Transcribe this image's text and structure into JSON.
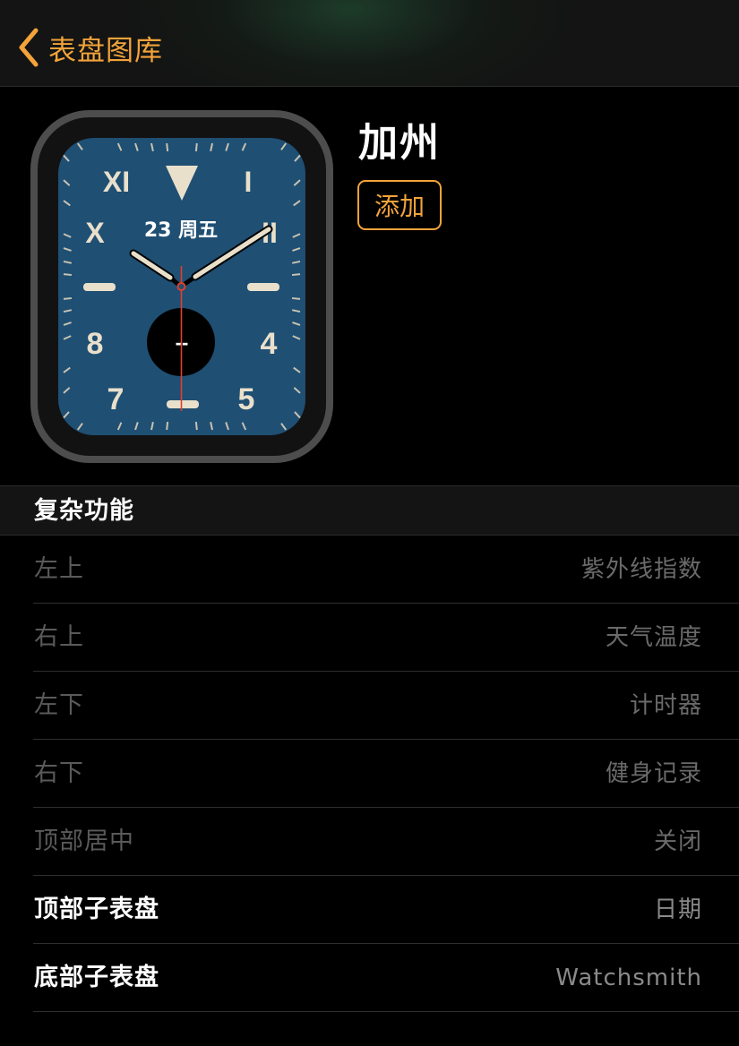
{
  "nav": {
    "back_label": "表盘图库",
    "back_icon": "chevron-left-icon",
    "accent_color": "#f3a33a"
  },
  "face": {
    "name": "加州",
    "add_label": "添加",
    "dial": {
      "numerals": [
        "XI",
        "I",
        "X",
        "II",
        "8",
        "4",
        "7",
        "5"
      ],
      "date_label": "23 周五",
      "subdial_label": "--",
      "dial_color": "#1f4f73"
    }
  },
  "complications": {
    "section_title": "复杂功能",
    "rows": [
      {
        "label": "左上",
        "value": "紫外线指数",
        "enabled": false
      },
      {
        "label": "右上",
        "value": "天气温度",
        "enabled": false
      },
      {
        "label": "左下",
        "value": "计时器",
        "enabled": false
      },
      {
        "label": "右下",
        "value": "健身记录",
        "enabled": false
      },
      {
        "label": "顶部居中",
        "value": "关闭",
        "enabled": false
      },
      {
        "label": "顶部子表盘",
        "value": "日期",
        "enabled": true
      },
      {
        "label": "底部子表盘",
        "value": "Watchsmith",
        "enabled": true
      }
    ]
  }
}
